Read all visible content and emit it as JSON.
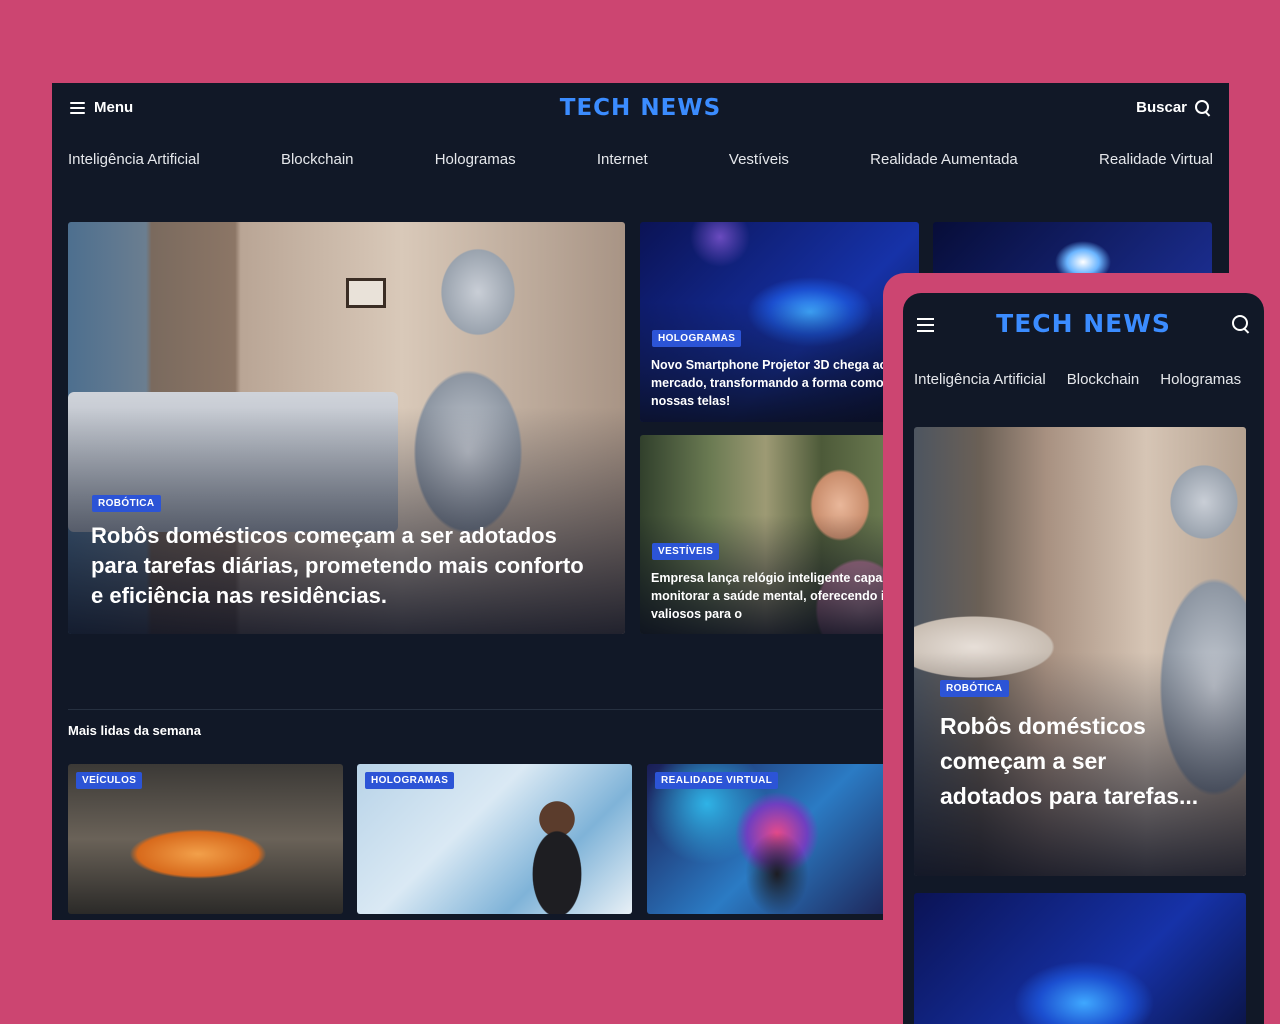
{
  "desktop": {
    "header": {
      "menu_label": "Menu",
      "logo": "TECH NEWS",
      "search_label": "Buscar"
    },
    "categories": [
      "Inteligência Artificial",
      "Blockchain",
      "Hologramas",
      "Internet",
      "Vestíveis",
      "Realidade Aumentada",
      "Realidade Virtual"
    ],
    "hero": {
      "badge": "ROBÓTICA",
      "title": "Robôs domésticos começam a ser adotados para tarefas diárias, prometendo mais conforto e eficiência nas residências."
    },
    "side_cards": [
      {
        "badge": "HOLOGRAMAS",
        "title": "Novo Smartphone Projetor 3D chega ao mercado, transformando a forma como vemos nossas telas!"
      },
      {
        "badge": "VESTÍVEIS",
        "title": "Empresa lança relógio inteligente capaz de monitorar a saúde mental, oferecendo insights valiosos para o"
      }
    ],
    "most_read": {
      "title": "Mais lidas da semana",
      "items": [
        {
          "badge": "VEÍCULOS"
        },
        {
          "badge": "HOLOGRAMAS"
        },
        {
          "badge": "REALIDADE VIRTUAL"
        }
      ]
    }
  },
  "mobile": {
    "logo": "TECH NEWS",
    "categories": [
      "Inteligência Artificial",
      "Blockchain",
      "Hologramas"
    ],
    "hero": {
      "badge": "ROBÓTICA",
      "title": "Robôs domésticos começam a ser adotados para tarefas..."
    }
  },
  "colors": {
    "background": "#cc4571",
    "surface": "#111827",
    "accent": "#3b8cff",
    "badge": "#2c54d6"
  }
}
